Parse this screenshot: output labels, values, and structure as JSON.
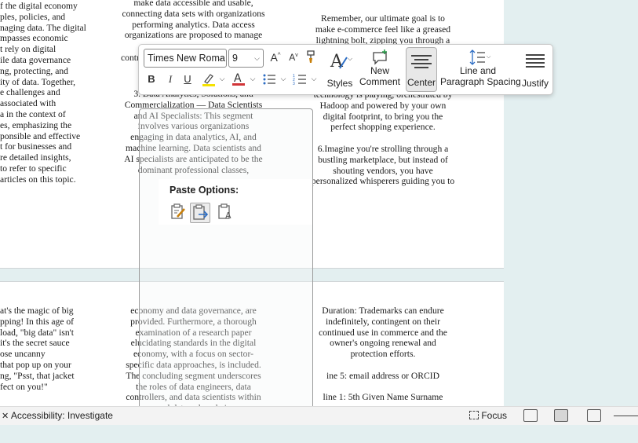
{
  "page1": {
    "col_left": "f the digital economy\nples, policies, and\nnaging data. The digital\nmpasses economic\nt rely on digital\nile data governance\nng, protecting, and\nity of data. Together,\ne challenges and\nassociated with\na in the context of\nes, emphasizing the\nponsible and effective\nt for businesses and\nre detailed insights,\nto refer to specific\narticles on this topic.",
    "col_mid_top": "make data accessible and usable,\nconnecting data sets with organizations\nperforming analytics. Data access\norganizations are proposed to manage",
    "col_mid_cut": "contr",
    "col_mid_bottom": "3. Data Analytics, Solutions, and\nCommercialization — Data Scientists\nand AI Specialists: This segment\ninvolves various organizations\nengaging in data analytics, AI, and\nmachine learning. Data scientists and\nAI specialists are anticipated to be the\ndominant professional classes,",
    "col_right_top": "Remember, our ultimate goal is to\nmake e-commerce feel like a greased\nlightning bolt, zipping you through a",
    "col_right_bottom": "technology is playing, orchestrated by\nHadoop and powered by your own\ndigital footprint, to bring you the\nperfect shopping experience.\n\n6.Imagine you're strolling through a\nbustling marketplace, but instead of\nshouting vendors, you have\npersonalized whisperers guiding you to"
  },
  "page2": {
    "col_left": "at's the magic of big\npping! In this age of\nload, \"big data\" isn't\nit's the secret sauce\nose uncanny\nthat pop up on your\nng, \"Psst, that jacket\nfect on you!\"",
    "col_mid": "economy and data governance, are\nprovided. Furthermore, a thorough\nexamination of a research paper\nelucidating standards in the digital\neconomy, with a focus on sector-\nspecific data approaches, is included.\nThe concluding segment underscores\nthe roles of data engineers, data\ncontrollers, and data scientists within\nnovel data value chains.",
    "col_right": "Duration: Trademarks can endure\nindefinitely, contingent on their\ncontinued use in commerce and the\nowner's ongoing renewal and\nprotection efforts.\n\nine 5: email address or ORCID\n\nline 1: 5th Given Name Surname"
  },
  "toolbar": {
    "font_name": "Times New Roma",
    "font_size": "9",
    "styles_label": "Styles",
    "new_comment_label": "New\nComment",
    "center_label": "Center",
    "line_spacing_label": "Line and\nParagraph Spacing",
    "justify_label": "Justify"
  },
  "paste": {
    "title": "Paste Options:"
  },
  "status": {
    "accessibility": "Accessibility: Investigate",
    "focus": "Focus"
  },
  "colors": {
    "highlight": "#f5e200",
    "font_color": "#d13438",
    "canvas": "#e3eff0"
  }
}
